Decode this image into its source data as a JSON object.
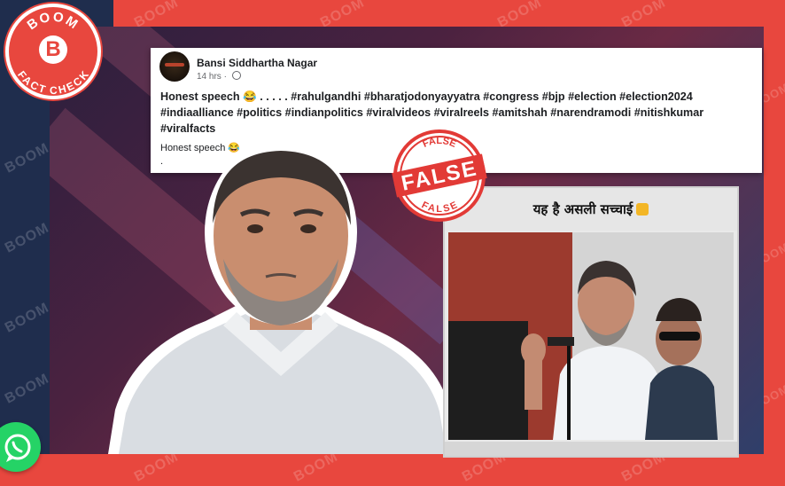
{
  "brand": {
    "name": "BOOM FACT CHECK",
    "logo_letter": "B",
    "top_text": "BOOM",
    "bottom_text": "FACT CHECK",
    "watermark": "BOOM",
    "accent_color": "#e8473e",
    "dark_color": "#1f2d4d"
  },
  "post": {
    "author": "Bansi Siddhartha Nagar",
    "time": "14 hrs",
    "dot_separator": "·",
    "text": "Honest speech 😂 . . . . . #rahulgandhi #bharatjodonyayyatra #congress #bjp #election #election2024 #indiaalliance #politics #indianpolitics #viralvideos #viralreels #amitshah #narendramodi #nitishkumar #viralfacts",
    "subtext": "Honest speech 😂",
    "trailing": "."
  },
  "stamp": {
    "label": "FALSE",
    "ring_text_top": "FALSE",
    "ring_text_bottom": "FALSE",
    "color": "#e23a36"
  },
  "video": {
    "caption": "यह है असली सच्चाई"
  },
  "icons": {
    "whatsapp": "whatsapp-icon",
    "globe": "globe-icon",
    "emoji": "laughing-emoji-icon",
    "wave": "waving-hand-icon"
  }
}
